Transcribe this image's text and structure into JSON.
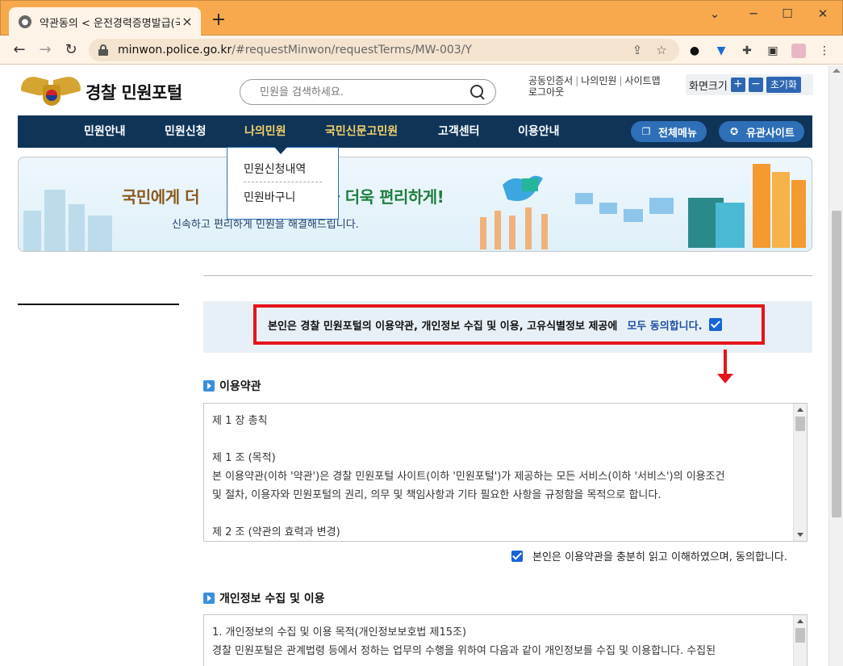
{
  "browser": {
    "tab_title": "약관동의 < 운전경력증명발급(국",
    "url_host": "minwon.police.go.kr",
    "url_path": "/#requestMinwon/requestTerms/MW-003/Y"
  },
  "header": {
    "logo_text": "경찰 민원포털",
    "search_placeholder": "민원을 검색하세요.",
    "util_links": [
      "공동인증서",
      "나의민원",
      "사이트맵",
      "로그아웃"
    ],
    "font_size_label": "화면크기",
    "font_plus": "+",
    "font_minus": "−",
    "font_reset": "초기화"
  },
  "gnb": {
    "items": [
      "민원안내",
      "민원신청",
      "나의민원",
      "국민신문고민원",
      "고객센터",
      "이용안내"
    ],
    "all_menu": "전체메뉴",
    "related_sites": "유관사이트"
  },
  "dropdown": {
    "items": [
      "민원신청내역",
      "민원바구니"
    ]
  },
  "banner": {
    "title_a": "국민에게 더 ",
    "title_b": "을 더욱 편리하게!",
    "subtitle": "신속하고 편리하게 민원을 해결해드립니다."
  },
  "agree_all": {
    "text": "본인은 경찰 민원포털의 이용약관, 개인정보 수집 및 이용, 고유식별정보 제공에",
    "emphasis": "모두 동의합니다.",
    "checked": true
  },
  "section_terms": {
    "title": "이용약관",
    "body": [
      "제 1 장 총칙",
      "",
      "제 1 조 (목적)",
      "본 이용약관(이하 '약관')은 경찰 민원포털 사이트(이하 '민원포털')가 제공하는 모든 서비스(이하 '서비스')의 이용조건",
      "및 절차, 이용자와 민원포털의 권리, 의무 및 책임사항과 기타 필요한 사항을 규정함을 목적으로 합니다.",
      "",
      "제 2 조 (약관의 효력과 변경)"
    ],
    "agree_label": "본인은 이용약관을 충분히 읽고 이해하였으며, 동의합니다.",
    "checked": true
  },
  "section_privacy": {
    "title": "개인정보 수집 및 이용",
    "body": [
      "1. 개인정보의 수집 및 이용 목적(개인정보보호법 제15조)",
      "경찰 민원포털은 관계법령 등에서 정하는 업무의 수행을 위하여 다음과 같이 개인정보를 수집 및 이용합니다. 수집된"
    ]
  },
  "colors": {
    "tab_strip": "#f8a94e",
    "gnb": "#0f3458",
    "accent_blue": "#2e6fb7",
    "highlight_red": "#e6141b"
  }
}
